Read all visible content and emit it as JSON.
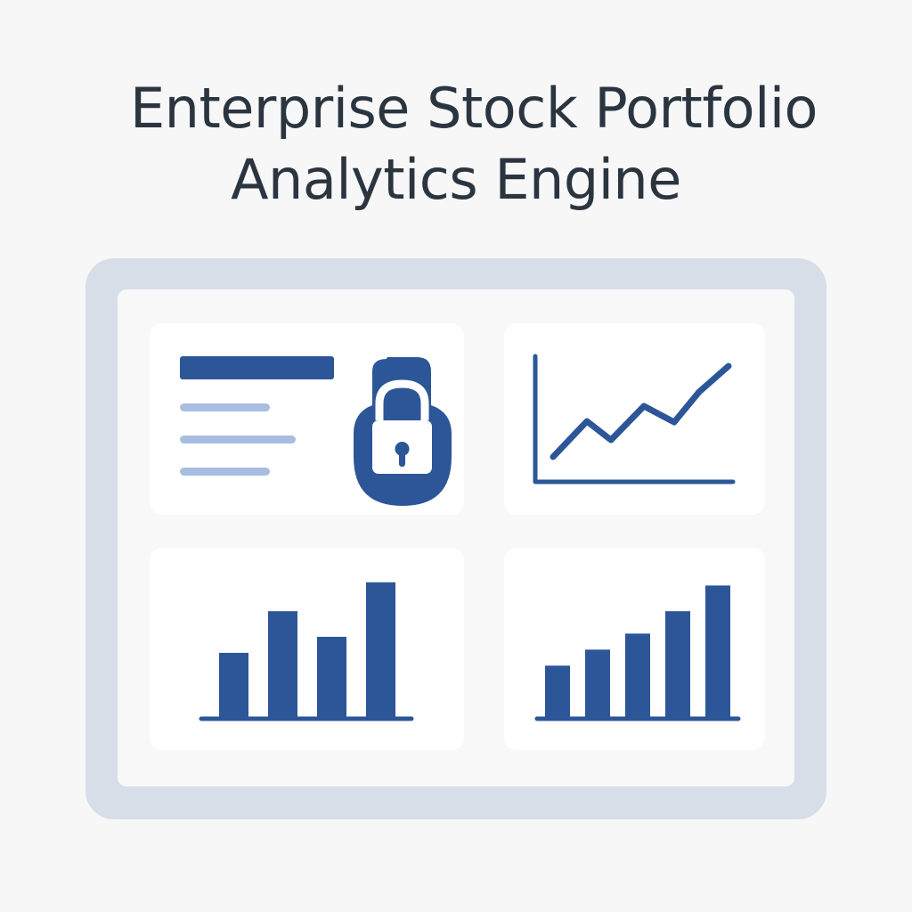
{
  "header": {
    "title_line1": "Enterprise Stock Portfolio",
    "title_line2": "Analytics Engine"
  },
  "colors": {
    "background": "#f7f7f7",
    "frame": "#d7dee7",
    "panel": "#f8f8f8",
    "card": "#ffffff",
    "primary": "#2c5697",
    "light_line": "#a8bde0",
    "title_text": "#2b3540"
  },
  "widgets": {
    "security": {
      "icon": "padlock-icon",
      "text_lines": 4
    },
    "line_chart": {
      "icon": "line-chart-icon",
      "trend": "rising"
    },
    "bar_chart_left": {
      "icon": "bar-chart-icon",
      "values": [
        2,
        3.3,
        2.5,
        4.2
      ]
    },
    "bar_chart_right": {
      "icon": "bar-chart-icon",
      "values": [
        1.6,
        2.1,
        2.6,
        3.3,
        4.1
      ]
    }
  }
}
